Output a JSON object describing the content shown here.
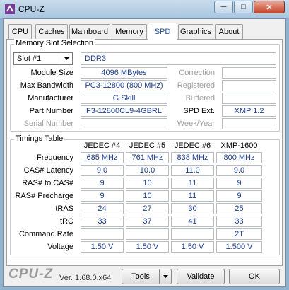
{
  "window": {
    "title": "CPU-Z",
    "minimize_glyph": "─",
    "maximize_glyph": "□",
    "close_glyph": "✕"
  },
  "tabs": [
    "CPU",
    "Caches",
    "Mainboard",
    "Memory",
    "SPD",
    "Graphics",
    "About"
  ],
  "active_tab": "SPD",
  "slot_section": {
    "group_label": "Memory Slot Selection",
    "slot_value": "Slot #1",
    "memory_type": "DDR3",
    "rows": [
      {
        "label": "Module Size",
        "value": "4096 MBytes",
        "right_label": "Correction",
        "right_value": ""
      },
      {
        "label": "Max Bandwidth",
        "value": "PC3-12800 (800 MHz)",
        "right_label": "Registered",
        "right_value": ""
      },
      {
        "label": "Manufacturer",
        "value": "G.Skill",
        "right_label": "Buffered",
        "right_value": ""
      },
      {
        "label": "Part Number",
        "value": "F3-12800CL9-4GBRL",
        "right_label": "SPD Ext.",
        "right_value": "XMP 1.2"
      },
      {
        "label": "Serial Number",
        "value": "",
        "right_label": "Week/Year",
        "right_value": ""
      }
    ]
  },
  "timings": {
    "group_label": "Timings Table",
    "columns": [
      "JEDEC #4",
      "JEDEC #5",
      "JEDEC #6",
      "XMP-1600"
    ],
    "rows": [
      {
        "label": "Frequency",
        "values": [
          "685 MHz",
          "761 MHz",
          "838 MHz",
          "800 MHz"
        ]
      },
      {
        "label": "CAS# Latency",
        "values": [
          "9.0",
          "10.0",
          "11.0",
          "9.0"
        ]
      },
      {
        "label": "RAS# to CAS#",
        "values": [
          "9",
          "10",
          "11",
          "9"
        ]
      },
      {
        "label": "RAS# Precharge",
        "values": [
          "9",
          "10",
          "11",
          "9"
        ]
      },
      {
        "label": "tRAS",
        "values": [
          "24",
          "27",
          "30",
          "25"
        ]
      },
      {
        "label": "tRC",
        "values": [
          "33",
          "37",
          "41",
          "33"
        ]
      },
      {
        "label": "Command Rate",
        "values": [
          "",
          "",
          "",
          "2T"
        ]
      },
      {
        "label": "Voltage",
        "values": [
          "1.50 V",
          "1.50 V",
          "1.50 V",
          "1.500 V"
        ]
      }
    ]
  },
  "footer": {
    "brand": "CPU-Z",
    "version": "Ver. 1.68.0.x64",
    "tools_label": "Tools",
    "validate_label": "Validate",
    "ok_label": "OK"
  }
}
